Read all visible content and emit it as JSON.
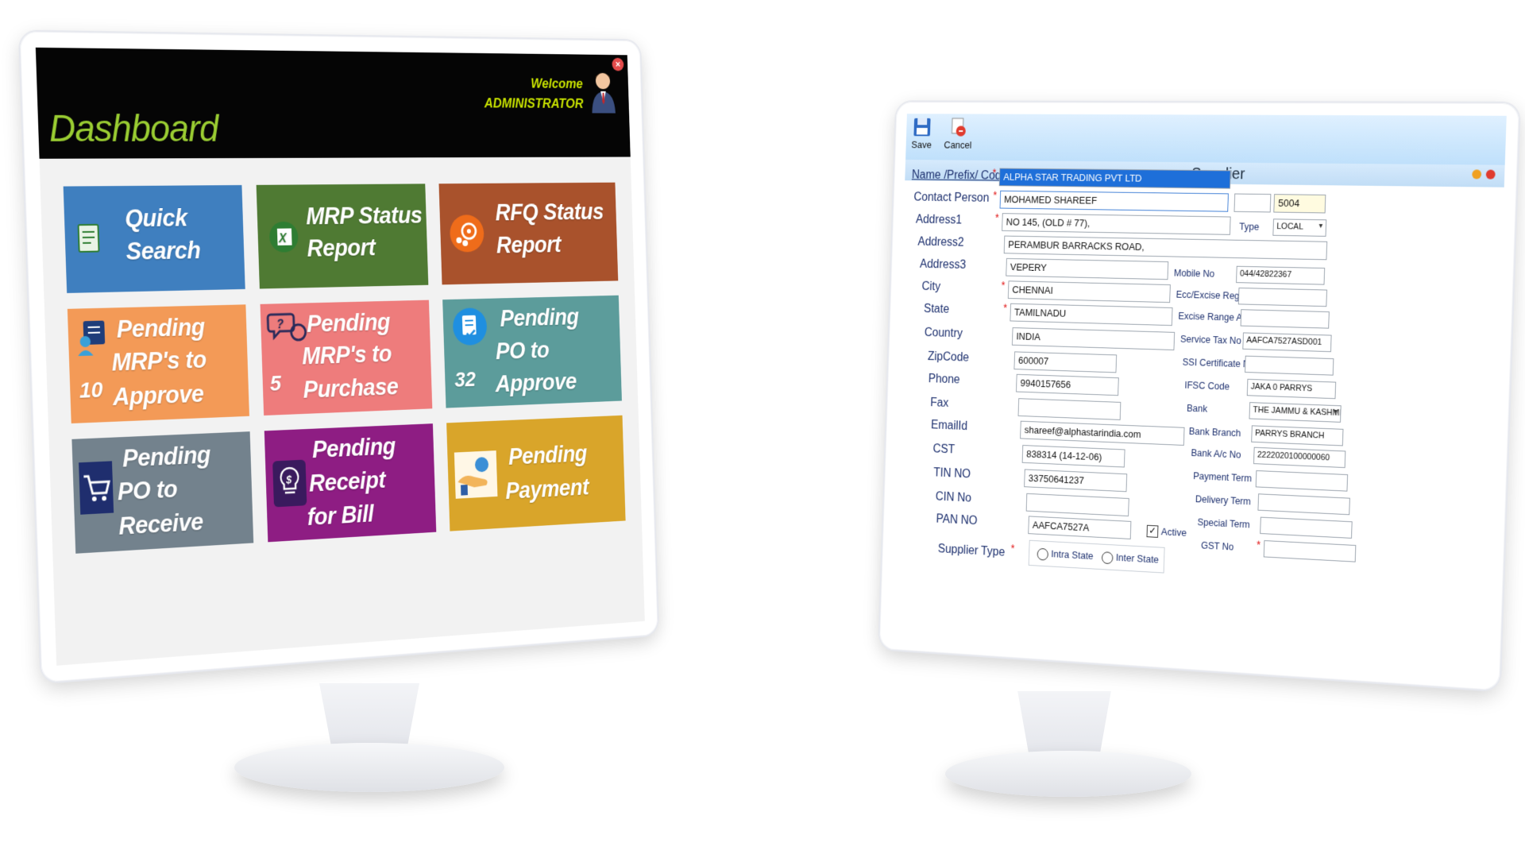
{
  "dashboard": {
    "title": "Dashboard",
    "welcome_label": "Welcome",
    "user_name": "ADMINISTRATOR",
    "close_glyph": "×",
    "tiles": [
      {
        "lines": [
          "Quick",
          "Search"
        ],
        "count": "",
        "color": "#3f7fbf",
        "icon": "document-search-icon"
      },
      {
        "lines": [
          "MRP Status",
          "Report"
        ],
        "count": "",
        "color": "#4f7a33",
        "icon": "excel-icon"
      },
      {
        "lines": [
          "RFQ Status",
          "Report"
        ],
        "count": "",
        "color": "#a9522c",
        "icon": "chart-target-icon"
      },
      {
        "lines": [
          "Pending",
          "MRP's to",
          "Approve"
        ],
        "count": "10",
        "color": "#f39a57",
        "icon": "people-approve-icon"
      },
      {
        "lines": [
          "Pending",
          "MRP's to",
          "Purchase"
        ],
        "count": "5",
        "color": "#ee7c7c",
        "icon": "question-chat-icon"
      },
      {
        "lines": [
          "Pending",
          "PO to",
          "Approve"
        ],
        "count": "32",
        "color": "#5c9c9b",
        "icon": "document-check-icon"
      },
      {
        "lines": [
          "Pending",
          "PO to",
          "Receive"
        ],
        "count": "",
        "color": "#73828d",
        "icon": "cart-icon"
      },
      {
        "lines": [
          "Pending",
          "Receipt",
          "for Bill"
        ],
        "count": "",
        "color": "#8e1d83",
        "icon": "bulb-dollar-icon"
      },
      {
        "lines": [
          "Pending",
          "Payment"
        ],
        "count": "",
        "color": "#d9a52a",
        "icon": "hand-payment-icon"
      }
    ]
  },
  "supplier": {
    "toolbar": {
      "save_label": "Save",
      "cancel_label": "Cancel"
    },
    "window_title": "Supplier",
    "left_labels": {
      "name": "Name /Prefix/ Code",
      "contact": "Contact Person",
      "address1": "Address1",
      "address2": "Address2",
      "address3": "Address3",
      "city": "City",
      "state": "State",
      "country": "Country",
      "zipcode": "ZipCode",
      "phone": "Phone",
      "fax": "Fax",
      "email": "EmailId",
      "cst": "CST",
      "tin": "TIN NO",
      "cin": "CIN No",
      "pan": "PAN NO",
      "supplier_type": "Supplier Type"
    },
    "values": {
      "name": "ALPHA STAR TRADING PVT LTD",
      "contact": "MOHAMED SHAREEF",
      "prefix": "",
      "code": "5004",
      "address1": "NO 145, (OLD # 77),",
      "address2": "PERAMBUR BARRACKS ROAD,",
      "address3": "VEPERY",
      "city": "CHENNAI",
      "state": "TAMILNADU",
      "country": "INDIA",
      "zipcode": "600007",
      "phone": "9940157656",
      "fax": "",
      "email": "shareef@alphastarindia.com",
      "cst": "838314 (14-12-06)",
      "tin": "33750641237",
      "cin": "",
      "pan": "AAFCA7527A"
    },
    "right_labels": {
      "type": "Type",
      "mobile": "Mobile No",
      "ecc": "Ecc/Excise Reg.No",
      "excise_range": "Excise Range Add",
      "service_tax": "Service Tax No",
      "ssi": "SSI Certificate No",
      "ifsc": "IFSC Code",
      "bank": "Bank",
      "bank_branch": "Bank Branch",
      "bank_ac": "Bank A/c No",
      "payment_term": "Payment Term",
      "delivery_term": "Delivery Term",
      "special_term": "Special Term",
      "gst": "GST No"
    },
    "right_values": {
      "type": "LOCAL",
      "mobile": "044/42822367",
      "ecc": "",
      "excise_range": "",
      "service_tax": "AAFCA7527ASD001",
      "ssi": "",
      "ifsc": "JAKA 0 PARRYS",
      "bank": "THE JAMMU & KASHMIR",
      "bank_branch": "PARRYS BRANCH",
      "bank_ac": "2222020100000060",
      "payment_term": "",
      "delivery_term": "",
      "special_term": "",
      "gst": ""
    },
    "active_label": "Active",
    "active_checked": true,
    "check_glyph": "✓",
    "dropdown_glyph": "▾",
    "required_glyph": "*",
    "radio_intra": "Intra State",
    "radio_inter": "Inter State"
  }
}
